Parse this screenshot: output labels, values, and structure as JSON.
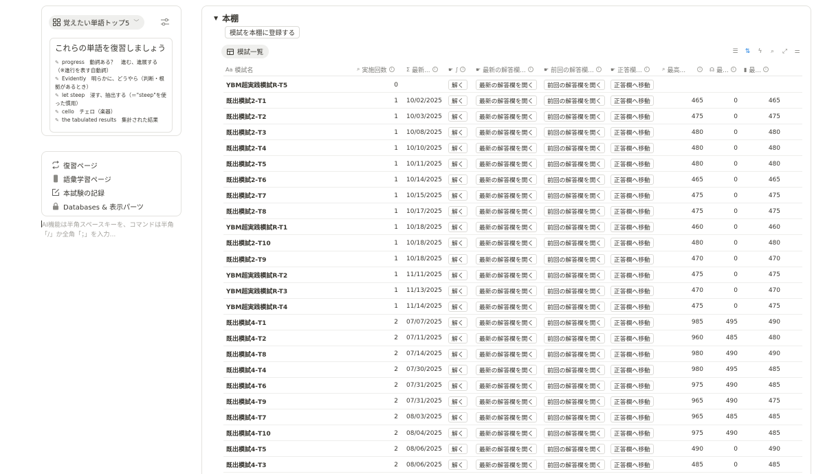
{
  "widget": {
    "chip_label": "覚えたい単語トップ5",
    "card_heading": "これらの単語を復習しましょう",
    "words": [
      {
        "term": "progress",
        "meaning": "動詞ある？　進む、進展する（※進行を表す自動詞）"
      },
      {
        "term": "Evidently",
        "meaning": "明らかに、どうやら（判断・根拠があるとき）"
      },
      {
        "term": "let steep",
        "meaning": "浸す、抽出する（＝\"steep\"を使った慣用）"
      },
      {
        "term": "cello",
        "meaning": "チェロ（楽器）"
      },
      {
        "term": "the tabulated results",
        "meaning": "集計された結果"
      }
    ]
  },
  "nav": {
    "items": [
      {
        "label": "復習ページ",
        "icon": "repeat-icon"
      },
      {
        "label": "語彙学習ページ",
        "icon": "phone-icon"
      },
      {
        "label": "本試験の記録",
        "icon": "edit-icon"
      },
      {
        "label": "Databases & 表示パーツ",
        "icon": "lock-icon"
      }
    ]
  },
  "hint": "AI機能は半角スペースキーを、コマンドは半角「/」か全角「；」を入力...",
  "main": {
    "section_title": "本棚",
    "register_label": "模試を本棚に登録する",
    "view_tab_label": "模試一覧",
    "columns": {
      "name": "模試名",
      "count": "実施回数",
      "latest_date": "最新...",
      "solve": "",
      "latest_sheet": "最新の解答欄...",
      "prev_sheet": "前回の解答欄...",
      "correct": "正答欄...",
      "best": "最高...",
      "listening": "最...",
      "reading": "最..."
    },
    "button_labels": {
      "solve": "解く",
      "latest": "最新の解答欄を開く",
      "prev": "前回の解答欄を開く",
      "correct": "正答欄へ移動"
    },
    "rows": [
      {
        "name": "YBM超実践模試R-T5",
        "count": "0",
        "date": "",
        "best": "",
        "listening": "",
        "reading": ""
      },
      {
        "name": "既出模試2-T1",
        "count": "1",
        "date": "10/02/2025",
        "best": "465",
        "listening": "0",
        "reading": "465"
      },
      {
        "name": "既出模試2-T2",
        "count": "1",
        "date": "10/03/2025",
        "best": "475",
        "listening": "0",
        "reading": "475"
      },
      {
        "name": "既出模試2-T3",
        "count": "1",
        "date": "10/08/2025",
        "best": "480",
        "listening": "0",
        "reading": "480"
      },
      {
        "name": "既出模試2-T4",
        "count": "1",
        "date": "10/10/2025",
        "best": "480",
        "listening": "0",
        "reading": "480"
      },
      {
        "name": "既出模試2-T5",
        "count": "1",
        "date": "10/11/2025",
        "best": "480",
        "listening": "0",
        "reading": "480"
      },
      {
        "name": "既出模試2-T6",
        "count": "1",
        "date": "10/14/2025",
        "best": "465",
        "listening": "0",
        "reading": "465"
      },
      {
        "name": "既出模試2-T7",
        "count": "1",
        "date": "10/15/2025",
        "best": "475",
        "listening": "0",
        "reading": "475"
      },
      {
        "name": "既出模試2-T8",
        "count": "1",
        "date": "10/17/2025",
        "best": "475",
        "listening": "0",
        "reading": "475"
      },
      {
        "name": "YBM超実践模試R-T1",
        "count": "1",
        "date": "10/18/2025",
        "best": "460",
        "listening": "0",
        "reading": "460"
      },
      {
        "name": "既出模試2-T10",
        "count": "1",
        "date": "10/18/2025",
        "best": "480",
        "listening": "0",
        "reading": "480"
      },
      {
        "name": "既出模試2-T9",
        "count": "1",
        "date": "10/18/2025",
        "best": "470",
        "listening": "0",
        "reading": "470"
      },
      {
        "name": "YBM超実践模試R-T2",
        "count": "1",
        "date": "11/11/2025",
        "best": "475",
        "listening": "0",
        "reading": "475"
      },
      {
        "name": "YBM超実践模試R-T3",
        "count": "1",
        "date": "11/13/2025",
        "best": "470",
        "listening": "0",
        "reading": "470"
      },
      {
        "name": "YBM超実践模試R-T4",
        "count": "1",
        "date": "11/14/2025",
        "best": "475",
        "listening": "0",
        "reading": "475"
      },
      {
        "name": "既出模試4-T1",
        "count": "2",
        "date": "07/07/2025",
        "best": "985",
        "listening": "495",
        "reading": "490"
      },
      {
        "name": "既出模試4-T2",
        "count": "2",
        "date": "07/11/2025",
        "best": "960",
        "listening": "485",
        "reading": "480"
      },
      {
        "name": "既出模試4-T8",
        "count": "2",
        "date": "07/14/2025",
        "best": "980",
        "listening": "490",
        "reading": "490"
      },
      {
        "name": "既出模試4-T4",
        "count": "2",
        "date": "07/30/2025",
        "best": "980",
        "listening": "495",
        "reading": "485"
      },
      {
        "name": "既出模試4-T6",
        "count": "2",
        "date": "07/31/2025",
        "best": "975",
        "listening": "490",
        "reading": "485"
      },
      {
        "name": "既出模試4-T9",
        "count": "2",
        "date": "07/31/2025",
        "best": "965",
        "listening": "490",
        "reading": "475"
      },
      {
        "name": "既出模試4-T7",
        "count": "2",
        "date": "08/03/2025",
        "best": "965",
        "listening": "485",
        "reading": "485"
      },
      {
        "name": "既出模試4-T10",
        "count": "2",
        "date": "08/04/2025",
        "best": "975",
        "listening": "490",
        "reading": "485"
      },
      {
        "name": "既出模試4-T5",
        "count": "2",
        "date": "08/06/2025",
        "best": "490",
        "listening": "0",
        "reading": "490"
      },
      {
        "name": "既出模試4-T3",
        "count": "2",
        "date": "08/06/2025",
        "best": "485",
        "listening": "0",
        "reading": "485"
      }
    ]
  }
}
